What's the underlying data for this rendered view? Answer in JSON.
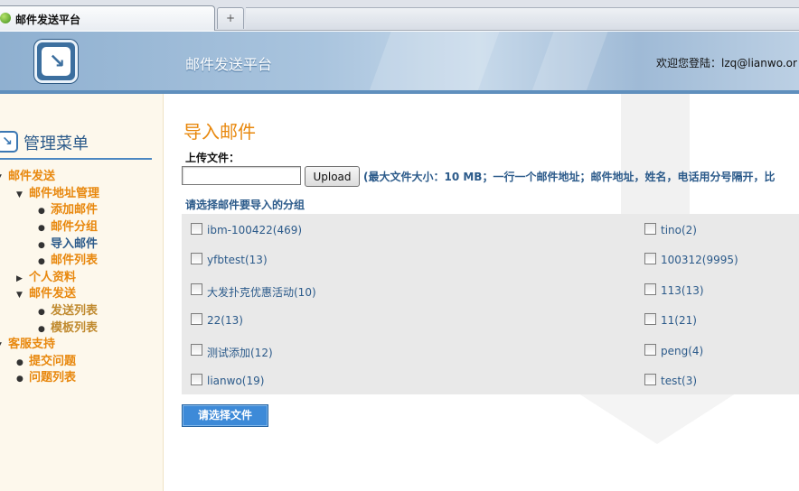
{
  "browser": {
    "tab_title": "邮件发送平台",
    "new_tab_symbol": "+"
  },
  "header": {
    "title": "邮件发送平台",
    "welcome": "欢迎您登陆：lzq@lianwo.or"
  },
  "sidebar": {
    "title": "管理菜单",
    "items": [
      {
        "label": "邮件发送",
        "level": 0,
        "marker": "open"
      },
      {
        "label": "邮件地址管理",
        "level": 1,
        "marker": "open"
      },
      {
        "label": "添加邮件",
        "level": 2
      },
      {
        "label": "邮件分组",
        "level": 2
      },
      {
        "label": "导入邮件",
        "level": 2,
        "active": true
      },
      {
        "label": "邮件列表",
        "level": 2
      },
      {
        "label": "个人资料",
        "level": 1,
        "marker": "closed"
      },
      {
        "label": "邮件发送",
        "level": 1,
        "marker": "open"
      },
      {
        "label": "发送列表",
        "level": 2
      },
      {
        "label": "模板列表",
        "level": 2
      },
      {
        "label": "客服支持",
        "level": 0,
        "marker": "open"
      },
      {
        "label": "提交问题",
        "level": 1
      },
      {
        "label": "问题列表",
        "level": 1
      }
    ]
  },
  "main": {
    "page_title": "导入邮件",
    "upload_label": "上传文件：",
    "upload_button": "Upload",
    "upload_note": "(最大文件大小：10 MB；一行一个邮件地址；邮件地址，姓名，电话用分号隔开，比",
    "select_label": "请选择邮件要导入的分组",
    "groups_left": [
      "ibm-100422(469)",
      "yfbtest(13)",
      "大发扑克优惠活动(10)",
      "22(13)",
      "测试添加(12)",
      "lianwo(19)"
    ],
    "groups_right": [
      "tino(2)",
      "100312(9995)",
      "113(13)",
      "11(21)",
      "peng(4)",
      "test(3)"
    ],
    "submit_button": "请选择文件"
  },
  "colors": {
    "accent_orange": "#e8880e",
    "link_blue": "#2b5a8a",
    "button_blue": "#3d8ad8"
  }
}
